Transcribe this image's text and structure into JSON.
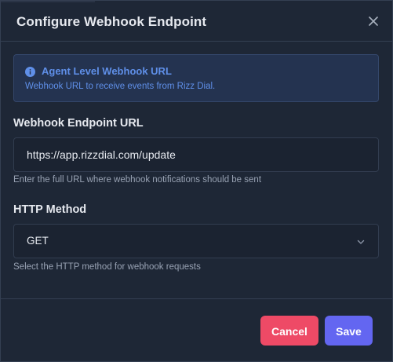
{
  "dialog": {
    "title": "Configure Webhook Endpoint",
    "close_icon": "close-icon"
  },
  "info": {
    "icon": "info-icon",
    "title": "Agent Level Webhook URL",
    "description": "Webhook URL to receive events from Rizz Dial."
  },
  "url_field": {
    "label": "Webhook Endpoint URL",
    "value": "https://app.rizzdial.com/update",
    "help": "Enter the full URL where webhook notifications should be sent"
  },
  "method_field": {
    "label": "HTTP Method",
    "selected": "GET",
    "icon": "chevron-down-icon",
    "help": "Select the HTTP method for webhook requests"
  },
  "actions": {
    "cancel_label": "Cancel",
    "save_label": "Save"
  },
  "colors": {
    "background": "#1e2736",
    "info_text": "#5f8fe8",
    "cancel": "#ee4a66",
    "save": "#6366f1"
  }
}
